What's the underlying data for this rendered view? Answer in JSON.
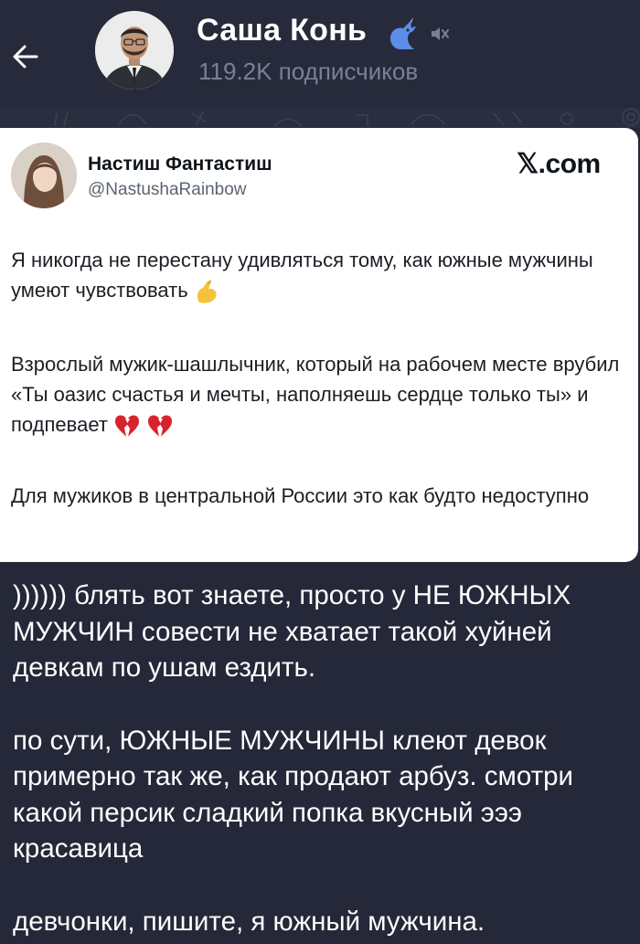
{
  "header": {
    "back_icon": "arrow-left-icon",
    "channel_name": "Саша Конь",
    "verified_icon": "unicorn-badge-icon",
    "muted_icon": "muted-speaker-icon",
    "subscribers": "119.2K подписчиков"
  },
  "tweet": {
    "author_name": "Настиш Фантастиш",
    "author_handle": "@NastushaRainbow",
    "source_site": "𝕏.com",
    "paragraph1": "Я никогда не перестану удивляться тому, как южные мужчины умеют чувствовать",
    "paragraph1_emoji": "pinched-fingers-emoji",
    "paragraph2": "Взрослый мужик-шашлычник, который на рабочем месте врубил «Ты оазис счастья и мечты, наполняешь сердце только ты» и подпевает",
    "paragraph2_emoji": "broken-heart-emoji",
    "paragraph3": "Для мужиков в центральной России это как будто недоступно"
  },
  "post": {
    "paragraph1": ")))))) блять вот знаете, просто у НЕ ЮЖНЫХ МУЖЧИН совести не хватает такой хуйней девкам по ушам ездить.",
    "paragraph2": "по сути, ЮЖНЫЕ МУЖЧИНЫ клеют девок примерно так же, как продают арбуз. смотри какой персик сладкий попка вкусный эээ красавица",
    "paragraph3": "девчонки, пишите, я южный мужчина."
  },
  "colors": {
    "background": "#252838",
    "header": "#262a3a",
    "subtitle": "#7b8096",
    "verified": "#5a8ee8",
    "card": "#ffffff"
  }
}
